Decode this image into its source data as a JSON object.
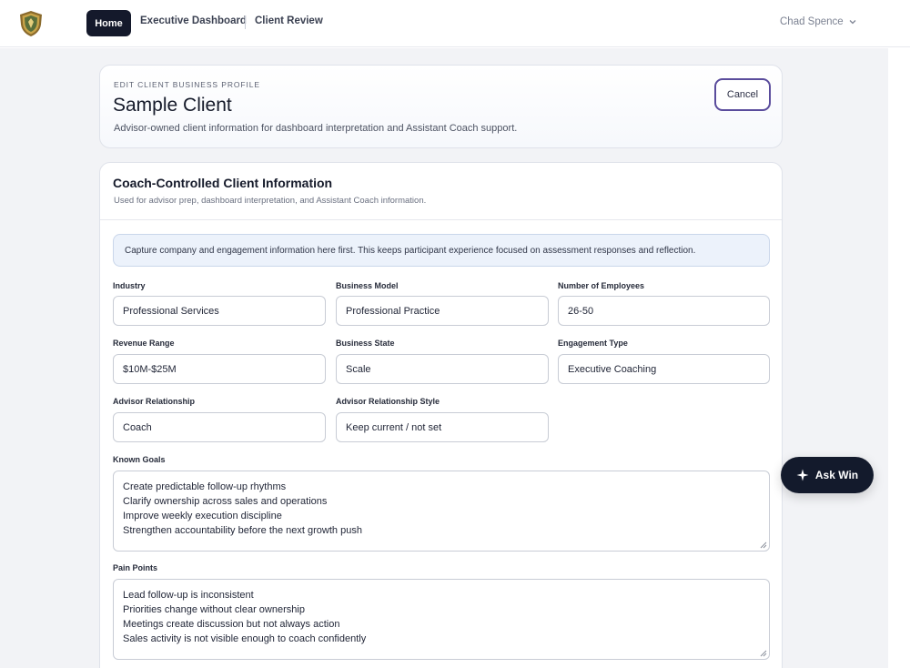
{
  "nav": {
    "home": "Home",
    "executive_dashboard": "Executive Dashboard",
    "client_review": "Client Review",
    "user_name": "Chad Spence"
  },
  "header": {
    "eyebrow": "EDIT CLIENT BUSINESS PROFILE",
    "title": "Sample Client",
    "subtitle": "Advisor-owned client information for dashboard interpretation and Assistant Coach support.",
    "cancel_label": "Cancel"
  },
  "section": {
    "title": "Coach-Controlled Client Information",
    "subtitle": "Used for advisor prep, dashboard interpretation, and Assistant Coach information.",
    "notice": "Capture company and engagement information here first. This keeps participant experience focused on assessment responses and reflection."
  },
  "fields": {
    "industry": {
      "label": "Industry",
      "value": "Professional Services"
    },
    "business_model": {
      "label": "Business Model",
      "value": "Professional Practice"
    },
    "employees": {
      "label": "Number of Employees",
      "value": "26-50"
    },
    "revenue_range": {
      "label": "Revenue Range",
      "value": "$10M-$25M"
    },
    "business_state": {
      "label": "Business State",
      "value": "Scale"
    },
    "engagement_type": {
      "label": "Engagement Type",
      "value": "Executive Coaching"
    },
    "advisor_relationship": {
      "label": "Advisor Relationship",
      "value": "Coach"
    },
    "advisor_relationship_style": {
      "label": "Advisor Relationship Style",
      "value": "Keep current / not set"
    }
  },
  "known_goals": {
    "label": "Known Goals",
    "lines": [
      "Create predictable follow-up rhythms",
      "Clarify ownership across sales and operations",
      "Improve weekly execution discipline",
      "Strengthen accountability before the next growth push"
    ]
  },
  "pain_points": {
    "label": "Pain Points",
    "lines": [
      "Lead follow-up is inconsistent",
      "Priorities change without clear ownership",
      "Meetings create discussion but not always action",
      "Sales activity is not visible enough to coach confidently"
    ]
  },
  "assistant": {
    "label": "Ask Win"
  },
  "icons": {
    "logo": "shield-logo-icon",
    "user_menu": "chevron-down-icon",
    "assistant": "sparkle-icon",
    "resize": "resize-grip-icon"
  },
  "colors": {
    "nav_active_bg": "#14192b",
    "cancel_border": "#5a4c9c",
    "notice_bg": "#ecf2fb",
    "assistant_bg": "#131a2c",
    "page_bg": "#f2f3f6"
  }
}
